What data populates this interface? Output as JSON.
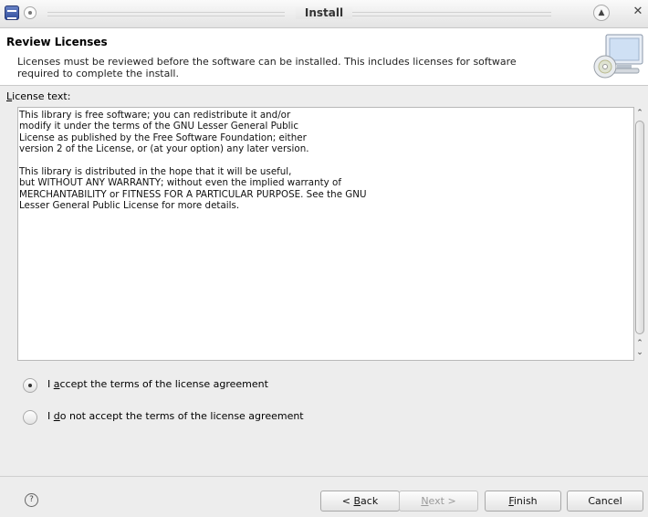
{
  "window": {
    "title": "Install"
  },
  "header": {
    "title": "Review Licenses",
    "description_line1": "Licenses must be reviewed before the software can be installed.  This includes licenses for software",
    "description_line2": "required to complete the install."
  },
  "license": {
    "label_mnemonic": "L",
    "label_rest": "icense text:",
    "text": "This library is free software; you can redistribute it and/or\nmodify it under the terms of the GNU Lesser General Public\nLicense as published by the Free Software Foundation; either\nversion 2 of the License, or (at your option) any later version.\n\nThis library is distributed in the hope that it will be useful,\nbut WITHOUT ANY WARRANTY; without even the implied warranty of\nMERCHANTABILITY or FITNESS FOR A PARTICULAR PURPOSE. See the GNU\nLesser General Public License for more details."
  },
  "options": {
    "accept": {
      "prefix": "I ",
      "mnemonic": "a",
      "rest": "ccept the terms of the license agreement",
      "selected": true
    },
    "decline": {
      "prefix": "I ",
      "mnemonic": "d",
      "rest": "o not accept the terms of the license agreement",
      "selected": false
    }
  },
  "buttons": {
    "help_icon": "?",
    "back_prefix": "< ",
    "back_mnemonic": "B",
    "back_rest": "ack",
    "next_mnemonic": "N",
    "next_rest": "ext >",
    "finish_mnemonic": "F",
    "finish_rest": "inish",
    "cancel": "Cancel"
  },
  "icons": {
    "app": "eclipse-icon",
    "window_menu": "window-menu-icon",
    "maximize": "maximize-icon",
    "close": "close-icon",
    "banner": "monitor-cd-icon",
    "help": "help-icon"
  }
}
